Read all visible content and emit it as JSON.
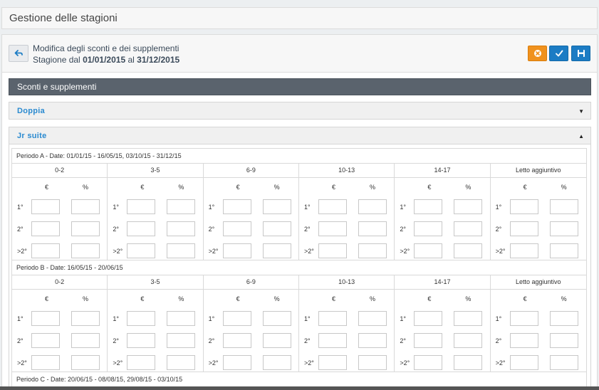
{
  "page": {
    "title": "Gestione delle stagioni"
  },
  "header": {
    "back_icon": "back-arrow-icon",
    "subtitle": "Modifica degli sconti e dei supplementi",
    "season_prefix": "Stagione dal ",
    "date_from": "01/01/2015",
    "season_mid": " al ",
    "date_to": "31/12/2015",
    "actions": [
      {
        "name": "cancel",
        "icon": "cancel-circle-icon",
        "color": "#f0921e"
      },
      {
        "name": "confirm",
        "icon": "checkmark-icon",
        "color": "#1c7cc4"
      },
      {
        "name": "save",
        "icon": "floppy-disk-icon",
        "color": "#1c7cc4"
      }
    ]
  },
  "section": {
    "title": "Sconti e supplementi"
  },
  "accordions": [
    {
      "label": "Doppia",
      "arrow": "▼",
      "state": "collapsed"
    },
    {
      "label": "Jr suite",
      "arrow": "▲",
      "state": "expanded"
    }
  ],
  "columns": [
    "0-2",
    "3-5",
    "6-9",
    "10-13",
    "14-17",
    "Letto aggiuntivo"
  ],
  "value_headers": {
    "eur": "€",
    "pct": "%"
  },
  "row_labels": [
    "1°",
    "2°",
    ">2°"
  ],
  "periods": [
    {
      "label": "Periodo A - Date: 01/01/15 - 16/05/15, 03/10/15 - 31/12/15"
    },
    {
      "label": "Periodo B - Date: 16/05/15 - 20/06/15"
    },
    {
      "label": "Periodo C - Date: 20/06/15 - 08/08/15, 29/08/15 - 03/10/15"
    }
  ]
}
